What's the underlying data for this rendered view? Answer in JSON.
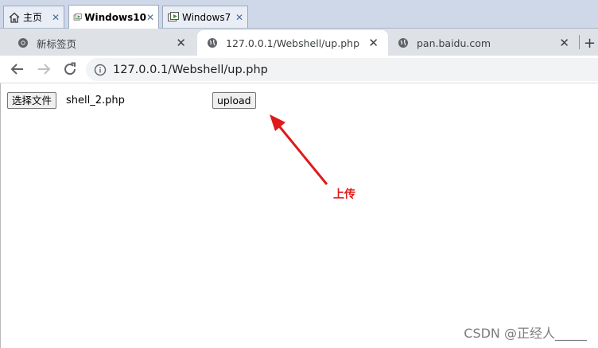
{
  "vm_tabs": [
    {
      "label": "主页",
      "icon": "home-icon",
      "active": false
    },
    {
      "label": "Windows10",
      "icon": "vm-icon",
      "active": true
    },
    {
      "label": "Windows7",
      "icon": "vm-icon",
      "active": false
    }
  ],
  "browser_tabs": [
    {
      "label": "新标签页",
      "icon": "chrome-icon",
      "active": false
    },
    {
      "label": "127.0.0.1/Webshell/up.php",
      "icon": "globe-icon",
      "active": true
    },
    {
      "label": "pan.baidu.com",
      "icon": "globe-icon",
      "active": false
    }
  ],
  "new_tab_symbol": "+",
  "address": {
    "url": "127.0.0.1/Webshell/up.php"
  },
  "form": {
    "choose_label": "选择文件",
    "file_name": "shell_2.php",
    "upload_label": "upload"
  },
  "annotation": {
    "text": "上传",
    "color": "#e01a1a"
  },
  "watermark": "CSDN @正经人_____"
}
